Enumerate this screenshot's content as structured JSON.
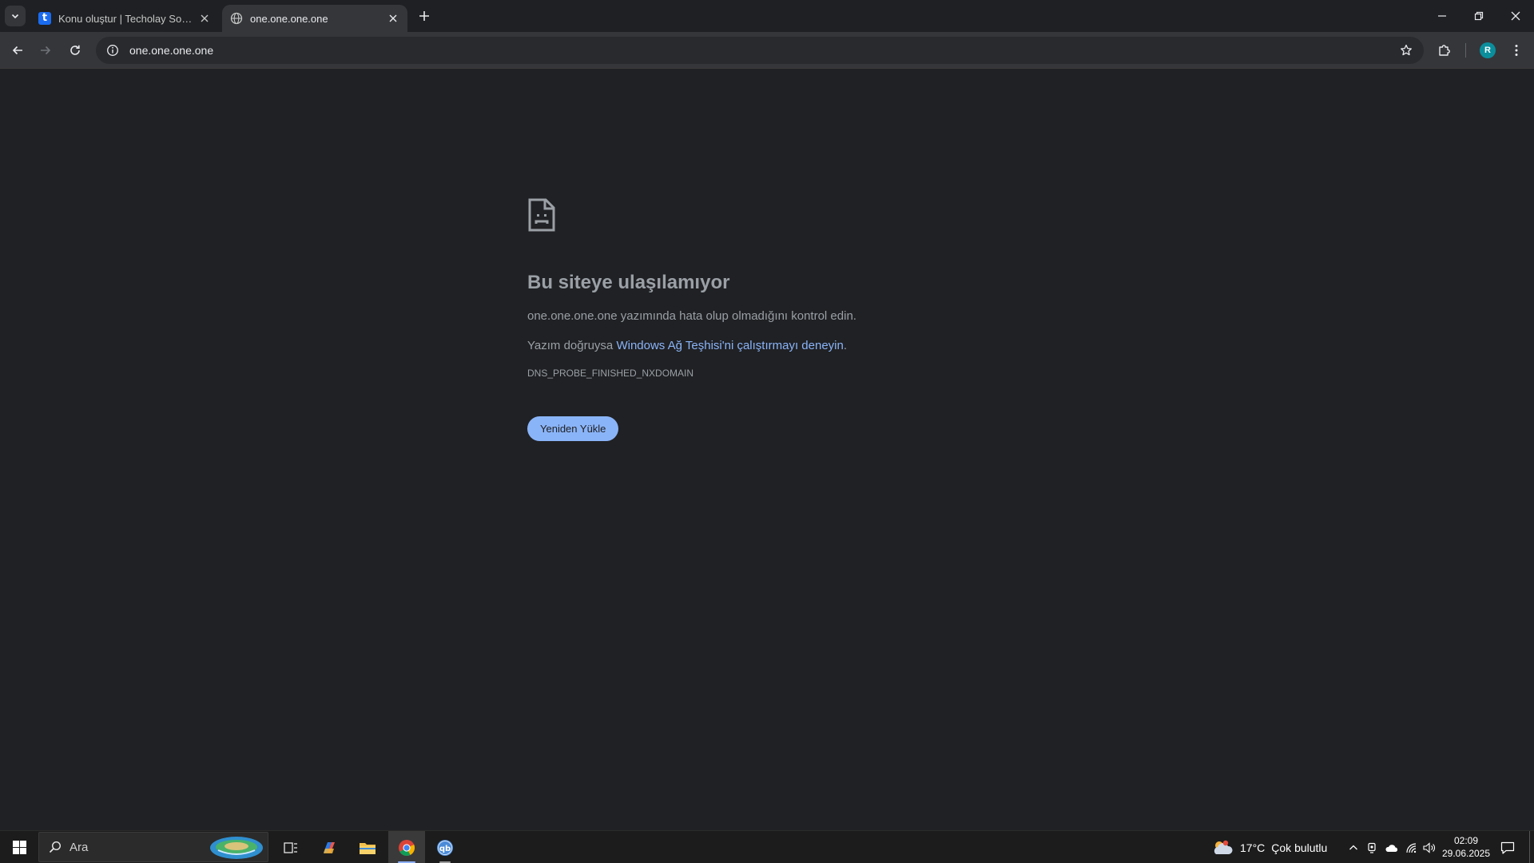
{
  "browser": {
    "tabs": [
      {
        "title": "Konu oluştur | Techolay Sosyal",
        "favicon": "techolay-t-icon",
        "active": false
      },
      {
        "title": "one.one.one.one",
        "favicon": "globe-icon",
        "active": true
      }
    ],
    "address": "one.one.one.one",
    "profile_initial": "R",
    "colors": {
      "frame": "#1f2023",
      "toolbar": "#35363a",
      "omnibox": "#282a2d",
      "page_bg": "#202124",
      "link": "#8ab4f8",
      "avatar": "#0b8e9c"
    }
  },
  "error_page": {
    "heading": "Bu siteye ulaşılamıyor",
    "line1": "one.one.one.one yazımında hata olup olmadığını kontrol edin.",
    "line2_prefix": "Yazım doğruysa ",
    "line2_link": "Windows Ağ Teşhisi'ni çalıştırmayı deneyin",
    "line2_suffix": ".",
    "error_code": "DNS_PROBE_FINISHED_NXDOMAIN",
    "reload_label": "Yeniden Yükle"
  },
  "taskbar": {
    "search_placeholder": "Ara",
    "weather_temp": "17°C",
    "weather_text": "Çok bulutlu",
    "time": "02:09",
    "date": "29.06.2025"
  }
}
